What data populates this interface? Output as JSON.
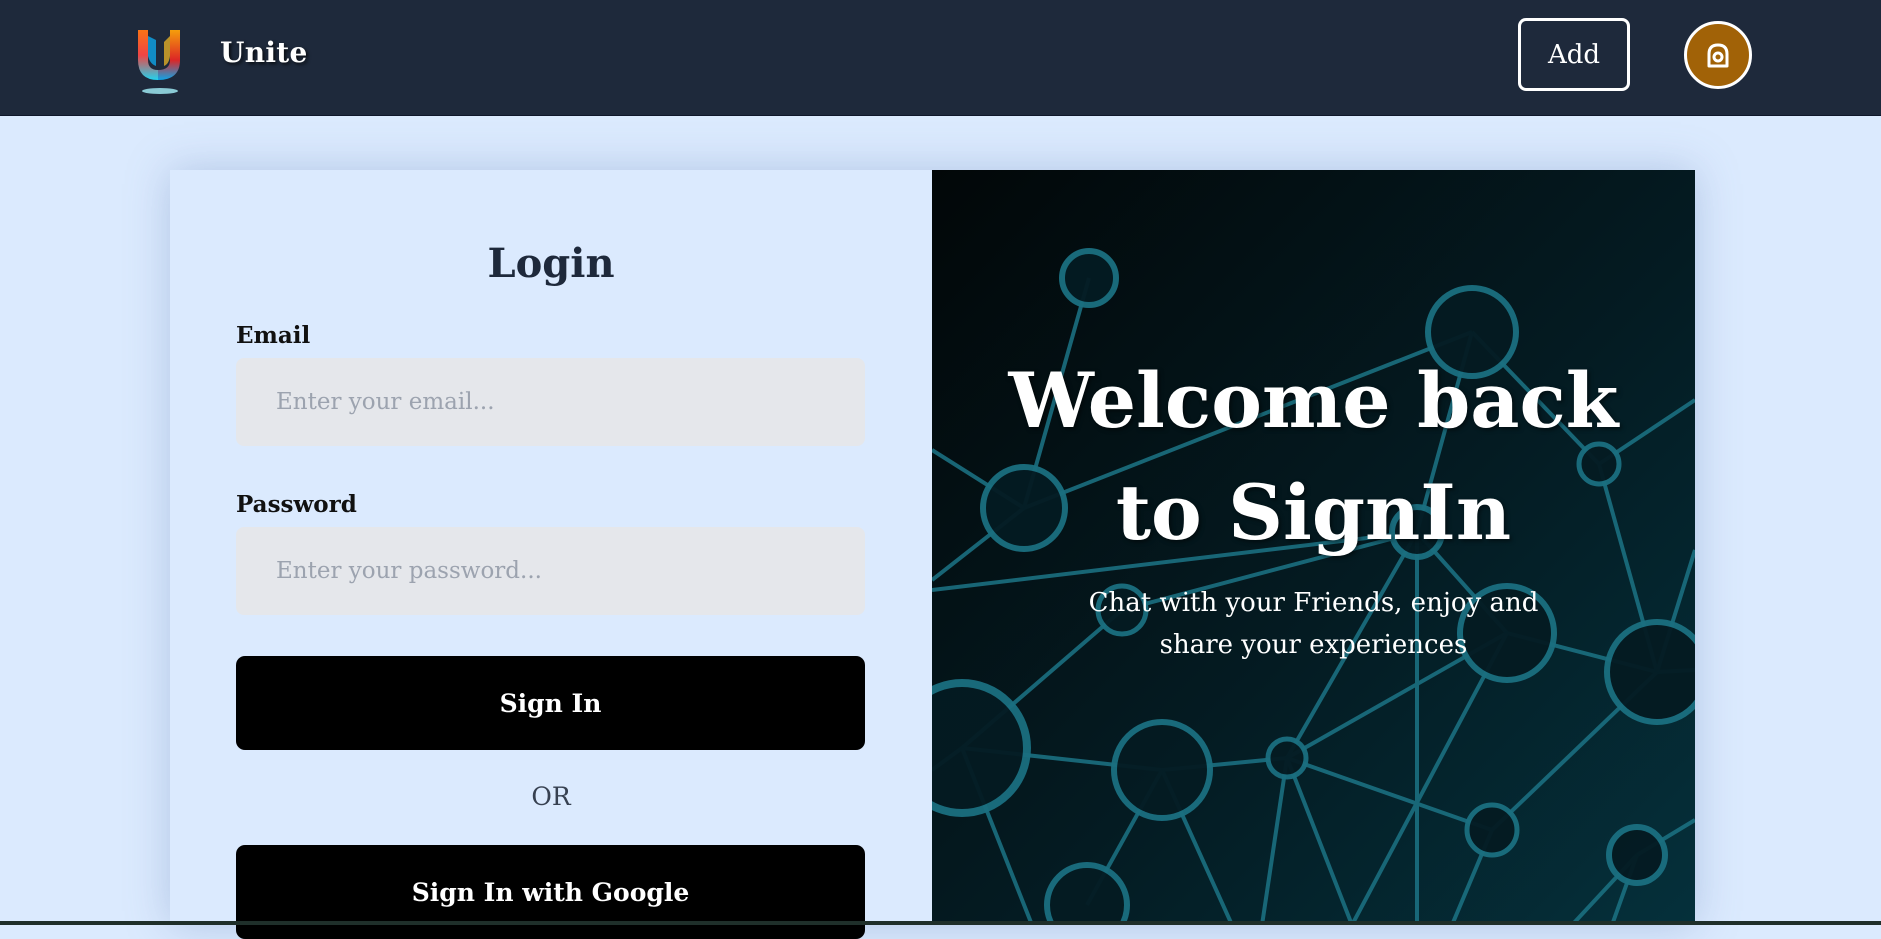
{
  "navbar": {
    "brand_name": "Unite",
    "add_label": "Add"
  },
  "login": {
    "title": "Login",
    "email_label": "Email",
    "email_placeholder": "Enter your email...",
    "password_label": "Password",
    "password_placeholder": "Enter your password...",
    "signin_label": "Sign In",
    "or_text": "OR",
    "google_label": "Sign In with Google"
  },
  "welcome": {
    "title_line1": "Welcome back",
    "title_line2": "to SignIn",
    "subtitle_line1": "Chat with your Friends, enjoy and",
    "subtitle_line2": "share your experiences"
  },
  "icons": {
    "logo": "unite-logo-icon",
    "avatar": "user-avatar-icon"
  },
  "colors": {
    "navbar_bg": "#1e293b",
    "page_bg": "#dbeafe",
    "avatar_bg": "#a16207",
    "button_bg": "#000000",
    "input_bg": "#e5e7eb",
    "network_stroke": "#1b6f80"
  }
}
